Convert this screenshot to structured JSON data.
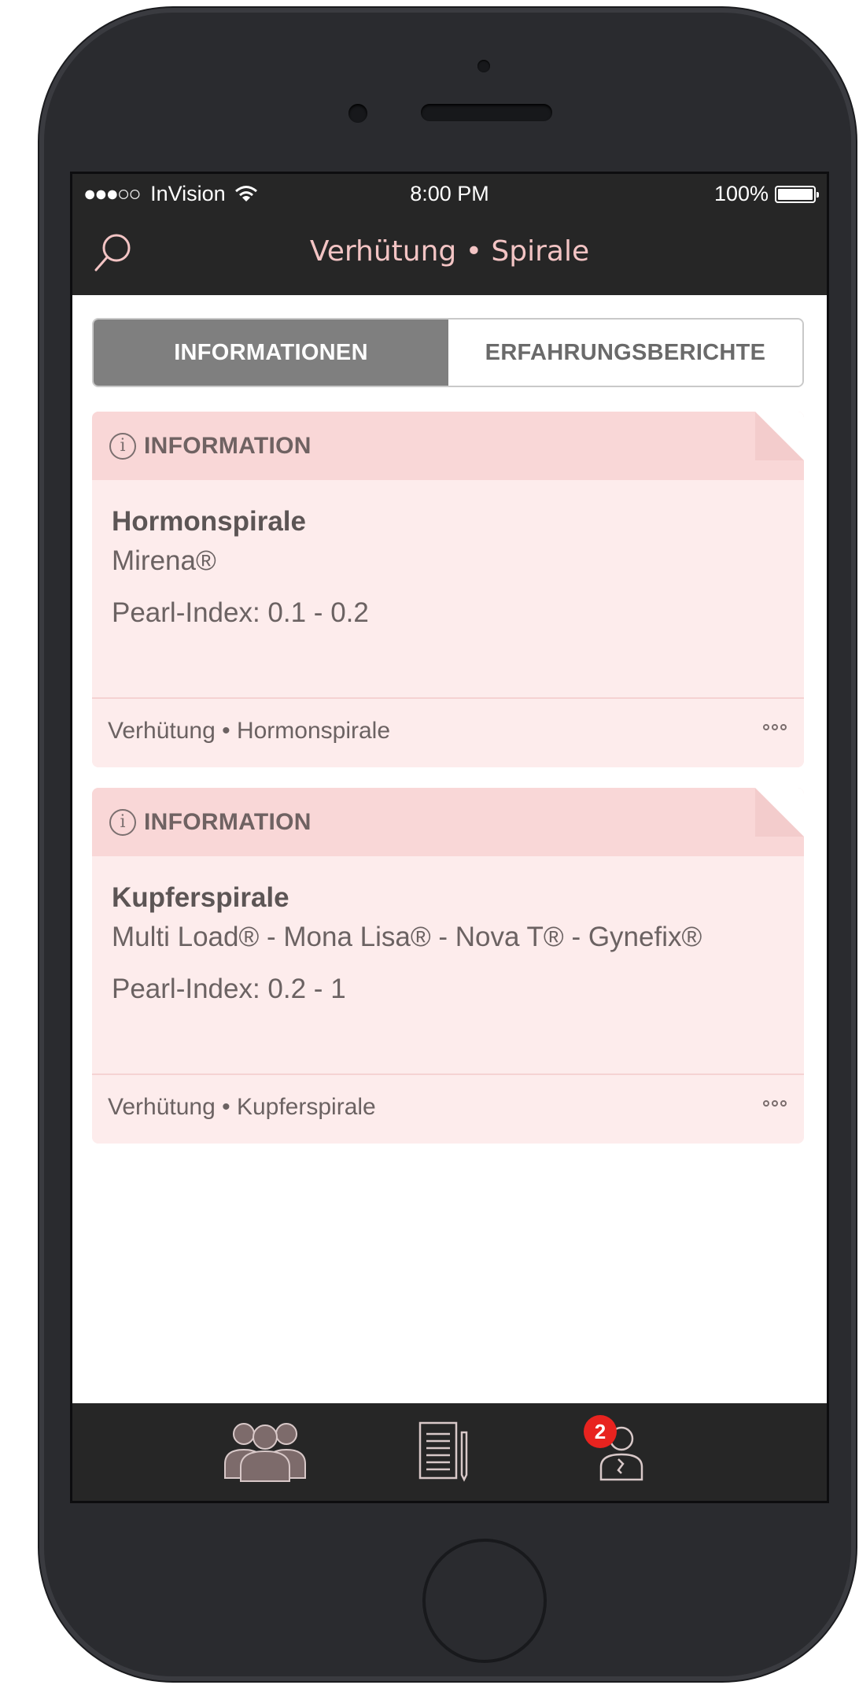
{
  "status_bar": {
    "signal": "●●●○○",
    "carrier": "InVision",
    "time": "8:00 PM",
    "battery": "100%"
  },
  "nav": {
    "title": "Verhütung • Spirale",
    "search_icon": "search-icon"
  },
  "segments": {
    "active": "INFORMATIONEN",
    "inactive": "ERFAHRUNGSBERICHTE"
  },
  "cards": [
    {
      "label": "INFORMATION",
      "title": "Hormonspirale",
      "brands": "Mirena®",
      "pearl_index": "Pearl-Index: 0.1 - 0.2",
      "footer": "Verhütung • Hormonspirale"
    },
    {
      "label": "INFORMATION",
      "title": "Kupferspirale",
      "brands": "Multi Load® - Mona Lisa® - Nova T® - Gynefix®",
      "pearl_index": "Pearl-Index: 0.2 - 1",
      "footer": "Verhütung • Kupferspirale"
    }
  ],
  "tab_bar": {
    "items": [
      {
        "icon": "community-icon"
      },
      {
        "icon": "notes-icon"
      },
      {
        "icon": "doctor-profile-icon",
        "badge": "2"
      }
    ]
  },
  "colors": {
    "bar_background": "#262626",
    "title_pink": "#f3c4c4",
    "card_background": "#fdecec",
    "card_header": "#f9d7d7",
    "badge_red": "#e8231f"
  }
}
